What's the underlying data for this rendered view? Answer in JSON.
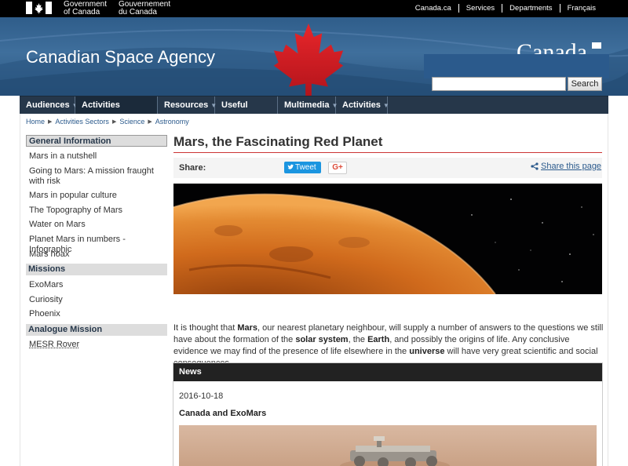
{
  "fip": {
    "gov_en_line1": "Government",
    "gov_en_line2": "of Canada",
    "gov_fr_line1": "Gouvernement",
    "gov_fr_line2": "du Canada",
    "links": [
      "Canada.ca",
      "Services",
      "Departments",
      "Français"
    ]
  },
  "banner": {
    "site_title": "Canadian Space Agency",
    "wordmark": "Canada",
    "search": {
      "placeholder": "",
      "button": "Search"
    }
  },
  "menu": {
    "items": [
      {
        "label": "Audiences",
        "active": false
      },
      {
        "label": "Activities Sectors",
        "active": true
      },
      {
        "label": "Resources",
        "active": false
      },
      {
        "label": "Useful Links",
        "active": false
      },
      {
        "label": "Multimedia",
        "active": false
      },
      {
        "label": "Activities",
        "active": false
      }
    ]
  },
  "breadcrumb": [
    "Home",
    "Activities Sectors",
    "Science",
    "Astronomy"
  ],
  "sidebar": {
    "general_heading": "General Information",
    "general_links": [
      "Mars in a nutshell",
      "Going to Mars: A mission fraught with risk",
      "Mars in popular culture",
      "The Topography of Mars",
      "Water on Mars",
      "Planet Mars in numbers - Infographic",
      "Mars hoax"
    ],
    "missions_heading": "Missions",
    "missions_links": [
      "ExoMars",
      "Curiosity",
      "Phoenix"
    ],
    "analogue_heading": "Analogue Mission",
    "analogue_links": [
      "MESR Rover"
    ]
  },
  "main": {
    "title": "Mars, the Fascinating Red Planet",
    "share_label": "Share:",
    "tweet": "Tweet",
    "gplus": "G+",
    "share_page": "Share this page",
    "intro": {
      "p1": "It is thought that ",
      "b1": "Mars",
      "p2": ", our nearest planetary neighbour, will supply a number of answers to the questions we still have about the formation of the ",
      "b2": "solar system",
      "p3": ", the ",
      "b3": "Earth",
      "p4": ", and possibly the origins of life. Any conclusive evidence we may find of the presence of life elsewhere in the ",
      "b4": "universe",
      "p5": " will have very great scientific and social consequences."
    },
    "news": {
      "heading": "News",
      "date": "2016-10-18",
      "item_title": "Canada and ExoMars"
    }
  },
  "colors": {
    "menu_bg": "#26374a",
    "rule_red": "#cc3333",
    "link_blue": "#2b5a8c",
    "banner_blue": "#2f5d8a"
  }
}
